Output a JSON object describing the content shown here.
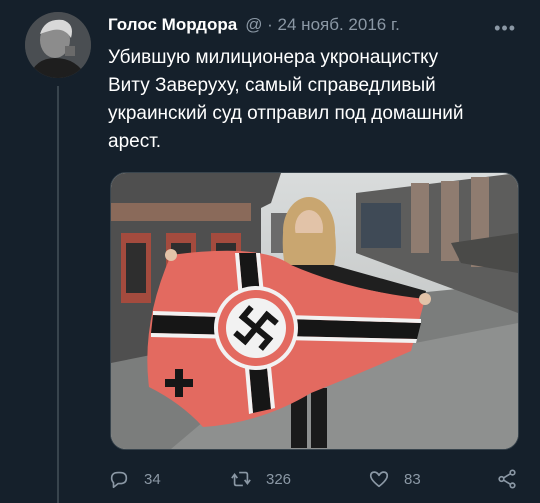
{
  "tweet": {
    "author_name": "Голос Мордора",
    "handle_and_date": "@ · 24 нояб. 2016 г.",
    "more_label": "•••",
    "text_lines": [
      "Убившую милиционера укронацистку",
      "Виту Заверуху, самый справедливый",
      "украинский суд отправил под домашний",
      "арест."
    ]
  },
  "actions": {
    "replies": "34",
    "retweets": "326",
    "likes": "83"
  },
  "icons": [
    "reply-icon",
    "retweet-icon",
    "like-icon",
    "share-icon"
  ],
  "colors": {
    "background": "#15202b",
    "text": "#ffffff",
    "muted": "#8b98a5",
    "border": "#38444d"
  }
}
